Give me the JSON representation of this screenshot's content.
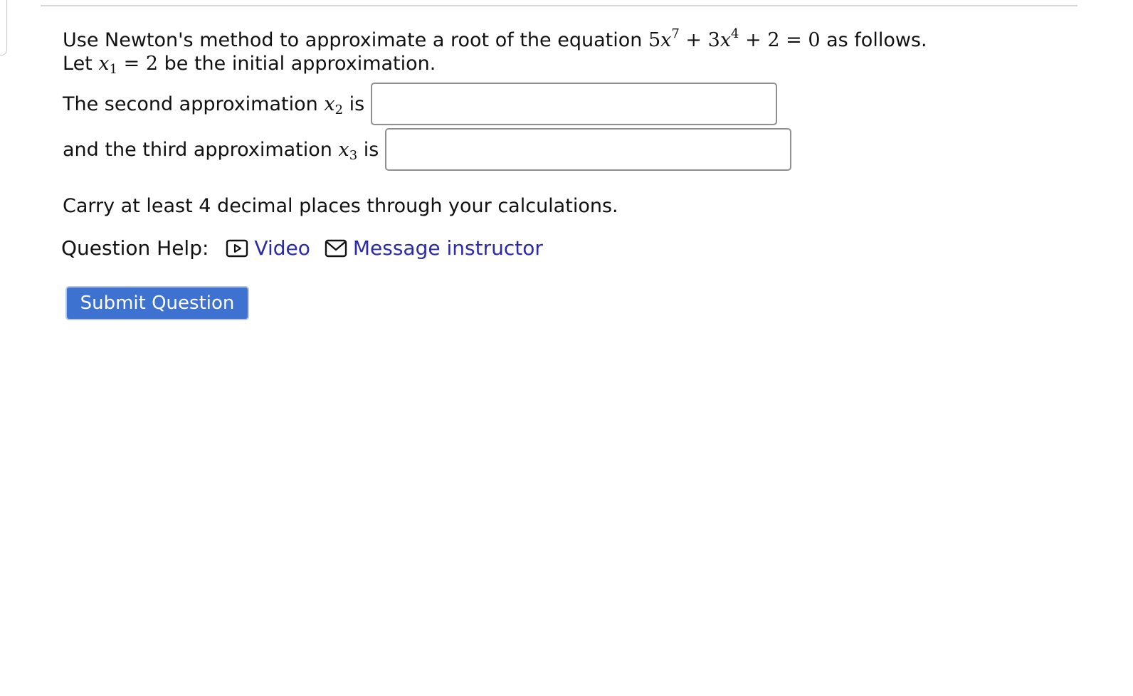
{
  "question": {
    "intro_text": "Use Newton's method to approximate a root of the equation",
    "equation": {
      "coef1": "5",
      "var1": "x",
      "exp1": "7",
      "plus1": "+",
      "coef2": "3",
      "var2": "x",
      "exp2": "4",
      "plus2": "+",
      "const": "2",
      "equals": "=",
      "rhs": "0"
    },
    "intro_suffix": "as follows.",
    "let_text": "Let",
    "initial_var": "x",
    "initial_sub": "1",
    "initial_equals": "=",
    "initial_value": "2",
    "initial_suffix": "be the initial approximation.",
    "second_label": "The second approximation",
    "second_var": "x",
    "second_sub": "2",
    "second_is": "is",
    "second_value": "",
    "third_label": "and the third approximation",
    "third_var": "x",
    "third_sub": "3",
    "third_is": "is",
    "third_value": "",
    "carry_note": "Carry at least 4 decimal places through your calculations."
  },
  "help": {
    "label": "Question Help:",
    "video_label": "Video",
    "video_icon": "play-icon",
    "message_label": "Message instructor",
    "message_icon": "mail-icon"
  },
  "submit": {
    "label": "Submit Question"
  },
  "colors": {
    "link": "#2a2aa8",
    "button": "#3e72d0",
    "input_border": "#8f8f8f"
  }
}
